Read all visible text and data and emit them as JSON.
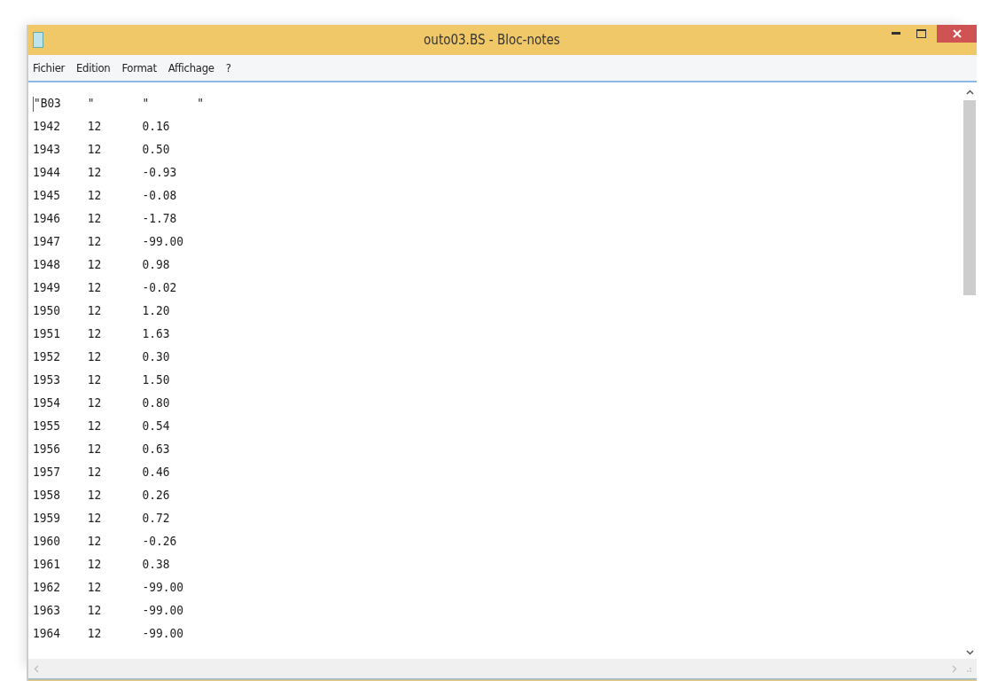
{
  "window": {
    "title": "outo03.BS - Bloc-notes"
  },
  "menu": [
    "Fichier",
    "Edition",
    "Format",
    "Affichage",
    "?"
  ],
  "lines": [
    "\"B03\t\"\t\"\t\"",
    "1942\t12\t0.16",
    "1943\t12\t0.50",
    "1944\t12\t-0.93",
    "1945\t12\t-0.08",
    "1946\t12\t-1.78",
    "1947\t12\t-99.00",
    "1948\t12\t0.98",
    "1949\t12\t-0.02",
    "1950\t12\t1.20",
    "1951\t12\t1.63",
    "1952\t12\t0.30",
    "1953\t12\t1.50",
    "1954\t12\t0.80",
    "1955\t12\t0.54",
    "1956\t12\t0.63",
    "1957\t12\t0.46",
    "1958\t12\t0.26",
    "1959\t12\t0.72",
    "1960\t12\t-0.26",
    "1961\t12\t0.38",
    "1962\t12\t-99.00",
    "1963\t12\t-99.00",
    "1964\t12\t-99.00"
  ]
}
